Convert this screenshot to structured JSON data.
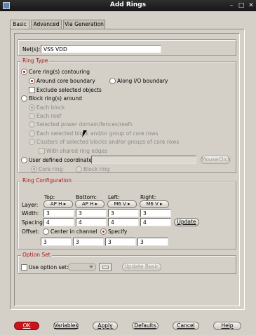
{
  "window": {
    "title": "Add Rings",
    "minimize": "–",
    "maximize": "□",
    "close": "✕"
  },
  "tabs": [
    "Basic",
    "Advanced",
    "Via Generation"
  ],
  "nets": {
    "label": "Net(s):",
    "value": "VSS VDD"
  },
  "ring_type": {
    "title": "Ring Type",
    "core_ring": "Core ring(s) contouring",
    "around_core": "Around core boundary",
    "along_io": "Along I/O boundary",
    "exclude": "Exclude selected objects",
    "block_ring": "Block ring(s) around",
    "each_block": "Each block",
    "each_reef": "Each reef",
    "selected_power": "Selected power domain/fences/reefs",
    "each_selected": "Each selected block and/or group of core rows",
    "clusters": "Clusters of selected blocks and/or groups of core rows",
    "shared_edges": "With shared ring edges",
    "user_defined": "User defined coordinates:",
    "mouse_click": "MouseClick",
    "core_ring_opt": "Core ring",
    "block_ring_opt": "Block ring"
  },
  "ring_config": {
    "title": "Ring Configuration",
    "columns": [
      "Top:",
      "Bottom:",
      "Left:",
      "Right:"
    ],
    "layer_label": "Layer:",
    "layers": [
      "AP H",
      "AP H",
      "M6 V",
      "M6 V"
    ],
    "width_label": "Width:",
    "widths": [
      "3",
      "3",
      "3",
      "3"
    ],
    "spacing_label": "Spacing:",
    "spacings": [
      "4",
      "4",
      "4",
      "4"
    ],
    "update": "Update",
    "offset_label": "Offset:",
    "center_channel": "Center in channel",
    "specify": "Specify",
    "offsets": [
      "3",
      "3",
      "3",
      "3"
    ]
  },
  "option_set": {
    "title": "Option Set",
    "use_label": "Use option set:",
    "update_basic": "Update Basic"
  },
  "footer": {
    "ok": "OK",
    "variables": "Variables",
    "apply": "Apply",
    "defaults": "Defaults",
    "cancel": "Cancel",
    "help": "Help"
  },
  "colors": {
    "accent": "#b01616",
    "ok_button": "#c8141a",
    "titlebar": "#1e1e1e"
  }
}
